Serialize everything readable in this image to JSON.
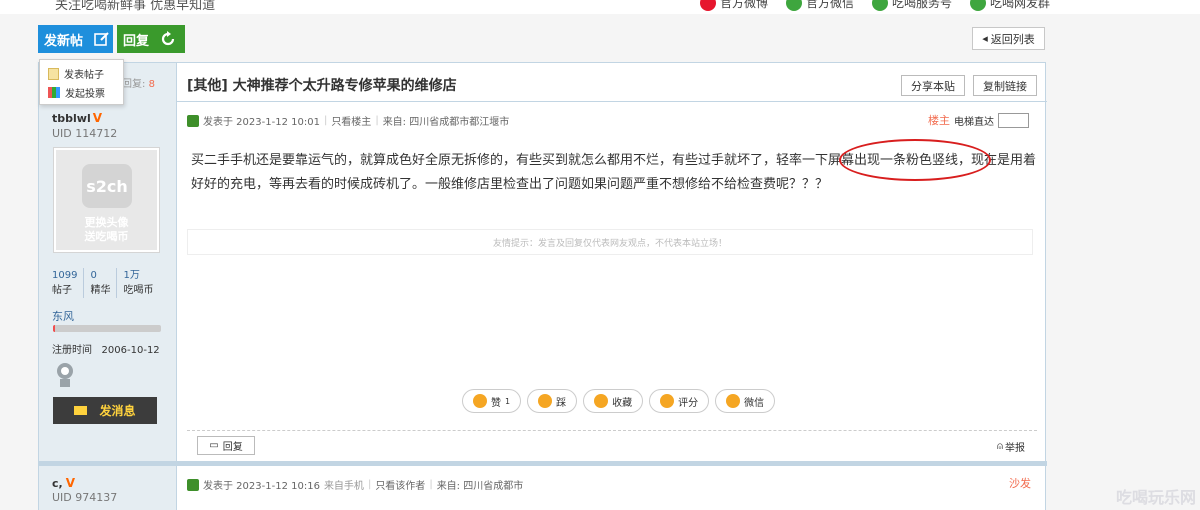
{
  "topbar": {
    "slogan": "关注吃喝新鲜事 优惠早知道",
    "links": [
      {
        "label": "官方微博",
        "icon": "weibo-icon",
        "color": "#e6162d"
      },
      {
        "label": "官方微信",
        "icon": "wechat-icon",
        "color": "#3ea63e"
      },
      {
        "label": "吃喝服务号",
        "icon": "service-icon",
        "color": "#3ea63e"
      },
      {
        "label": "吃喝网发群",
        "icon": "group-icon",
        "color": "#3ea63e"
      }
    ]
  },
  "toolbar": {
    "post_label": "发新帖",
    "reply_label": "回复",
    "back_label": "返回列表"
  },
  "dropdown": {
    "items": [
      "发表帖子",
      "发起投票"
    ]
  },
  "thread": {
    "views_label": "回复:",
    "views_value": "8",
    "title": "[其他] 大神推荐个太升路专修苹果的维修店",
    "share_label": "分享本贴",
    "copy_label": "复制链接"
  },
  "post1": {
    "author": "tbblwl",
    "badge": "V",
    "uid": "UID 114712",
    "avatar_logo": "s2ch",
    "avatar_text": [
      "更换头像",
      "送吃喝币"
    ],
    "stats": [
      {
        "num": "1099",
        "label": "帖子"
      },
      {
        "num": "0",
        "label": "精华"
      },
      {
        "num": "1万",
        "label": "吃喝币"
      }
    ],
    "rank": "东风",
    "rank_progress": 0.02,
    "reg_label": "注册时间",
    "reg_date": "2006-10-12",
    "msg_label": "发消息",
    "posted": "发表于 2023-1-12 10:01",
    "only_op": "只看楼主",
    "from": "来自: 四川省成都市都江堰市",
    "floor": "楼主",
    "elevator": "电梯直达",
    "body": "买二手手机还是要靠运气的，就算成色好全原无拆修的，有些买到就怎么都用不烂，有些过手就坏了，轻率一下屏幕出现一条粉色竖线，现在是用着好好的充电，等再去看的时候成砖机了。一般维修店里检查出了问题如果问题严重不想修给不给检查费呢？？？",
    "tip": "友情提示：发言及回复仅代表网友观点，不代表本站立场！",
    "actions": [
      {
        "label": "赞",
        "count": "1",
        "icon": "thumbs-up-icon"
      },
      {
        "label": "踩",
        "count": "",
        "icon": "thumbs-down-icon"
      },
      {
        "label": "收藏",
        "count": "",
        "icon": "star-icon"
      },
      {
        "label": "评分",
        "count": "",
        "icon": "check-icon"
      },
      {
        "label": "微信",
        "count": "",
        "icon": "wechat-icon"
      }
    ],
    "reply_label": "回复",
    "report_label": "举报"
  },
  "post2": {
    "author": "c,",
    "badge": "V",
    "uid": "UID 974137",
    "posted": "发表于 2023-1-12 10:16",
    "device": "来自手机",
    "only_author": "只看该作者",
    "from": "来自: 四川省成都市",
    "floor": "沙发"
  },
  "watermark": "吃喝玩乐网"
}
